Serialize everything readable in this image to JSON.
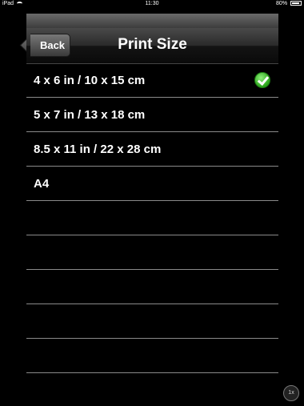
{
  "status_bar": {
    "device": "iPad",
    "time": "11:30",
    "battery": "80%"
  },
  "navbar": {
    "back_label": "Back",
    "title": "Print Size"
  },
  "print_sizes": [
    {
      "label": "4 x 6 in / 10 x 15 cm",
      "selected": true
    },
    {
      "label": "5 x 7 in / 13 x 18 cm",
      "selected": false
    },
    {
      "label": "8.5 x 11 in / 22 x 28 cm",
      "selected": false
    },
    {
      "label": "A4",
      "selected": false
    }
  ],
  "zoom_button": "1x",
  "colors": {
    "background": "#000000",
    "separator": "#8a8a8a",
    "check_green": "#2aa31a"
  }
}
